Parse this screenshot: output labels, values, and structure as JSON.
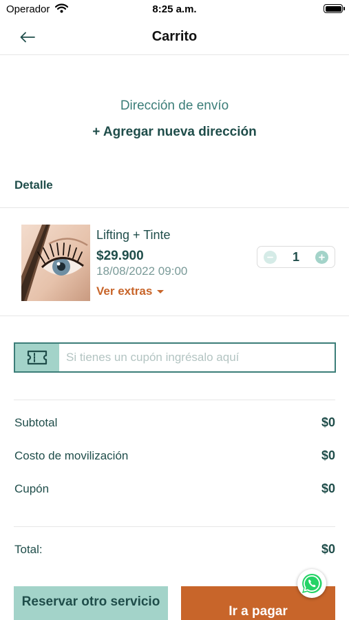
{
  "status_bar": {
    "carrier": "Operador",
    "time": "8:25 a.m."
  },
  "nav": {
    "title": "Carrito",
    "back_icon": "arrow-left-icon"
  },
  "address": {
    "label": "Dirección de envío",
    "add_link": "+ Agregar nueva dirección"
  },
  "detail": {
    "title": "Detalle"
  },
  "product": {
    "name": "Lifting + Tinte",
    "price": "$29.900",
    "datetime": "18/08/2022 09:00",
    "extras_link": "Ver extras",
    "quantity": "1"
  },
  "coupon": {
    "placeholder": "Si tienes un cupón ingrésalo aquí",
    "icon": "ticket-icon"
  },
  "summary": {
    "subtotal_label": "Subtotal",
    "subtotal_value": "$0",
    "shipping_label": "Costo de movilización",
    "shipping_value": "$0",
    "coupon_label": "Cupón",
    "coupon_value": "$0",
    "total_label": "Total:",
    "total_value": "$0"
  },
  "actions": {
    "reserve_label": "Reservar otro servicio",
    "pay_label": "Ir a pagar"
  },
  "colors": {
    "primary": "#1f4d4a",
    "accent": "#3b7d78",
    "mint": "#a3d3c9",
    "orange": "#c8652a"
  }
}
